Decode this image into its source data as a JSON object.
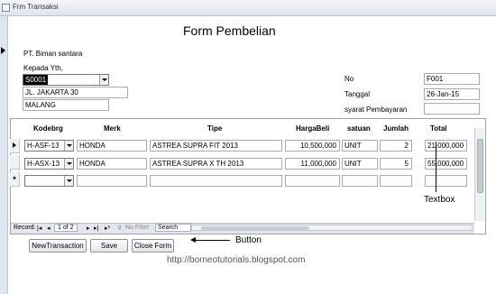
{
  "window": {
    "title": "Frm Transaksi"
  },
  "form": {
    "title": "Form Pembelian",
    "company": "PT. Biman santara",
    "to_label": "Kepada Yth,",
    "supplier_code": "S0001",
    "address": "JL. JAKARTA 30",
    "city": "MALANG",
    "no_label": "No",
    "no_value": "F001",
    "date_label": "Tanggal",
    "date_value": "26-Jan-15",
    "payment_label": "syarat Pembayaran",
    "payment_value": ""
  },
  "table": {
    "headers": [
      "Kodebrg",
      "Merk",
      "Tipe",
      "HargaBeli",
      "satuan",
      "Jumlah",
      "Total"
    ],
    "rows": [
      {
        "kodebrg": "H-ASF-13",
        "merk": "HONDA",
        "tipe": "ASTREA SUPRA FIT 2013",
        "hargabeli": "10,500,000",
        "satuan": "UNIT",
        "jumlah": "2",
        "total": "21,000,000"
      },
      {
        "kodebrg": "H-ASX-13",
        "merk": "HONDA",
        "tipe": "ASTREA SUPRA X TH 2013",
        "hargabeli": "11,000,000",
        "satuan": "UNIT",
        "jumlah": "5",
        "total": "55,000,000"
      }
    ]
  },
  "navigation": {
    "record_label": "Record:",
    "position": "1 of 2",
    "filter": "No Filter",
    "search": "Search"
  },
  "buttons": {
    "new": "NewTransaction",
    "save": "Save",
    "close": "Close Form"
  },
  "annotations": {
    "textbox": "Textbox",
    "button": "Button",
    "url": "http://borneotutorials.blogspot.com"
  }
}
